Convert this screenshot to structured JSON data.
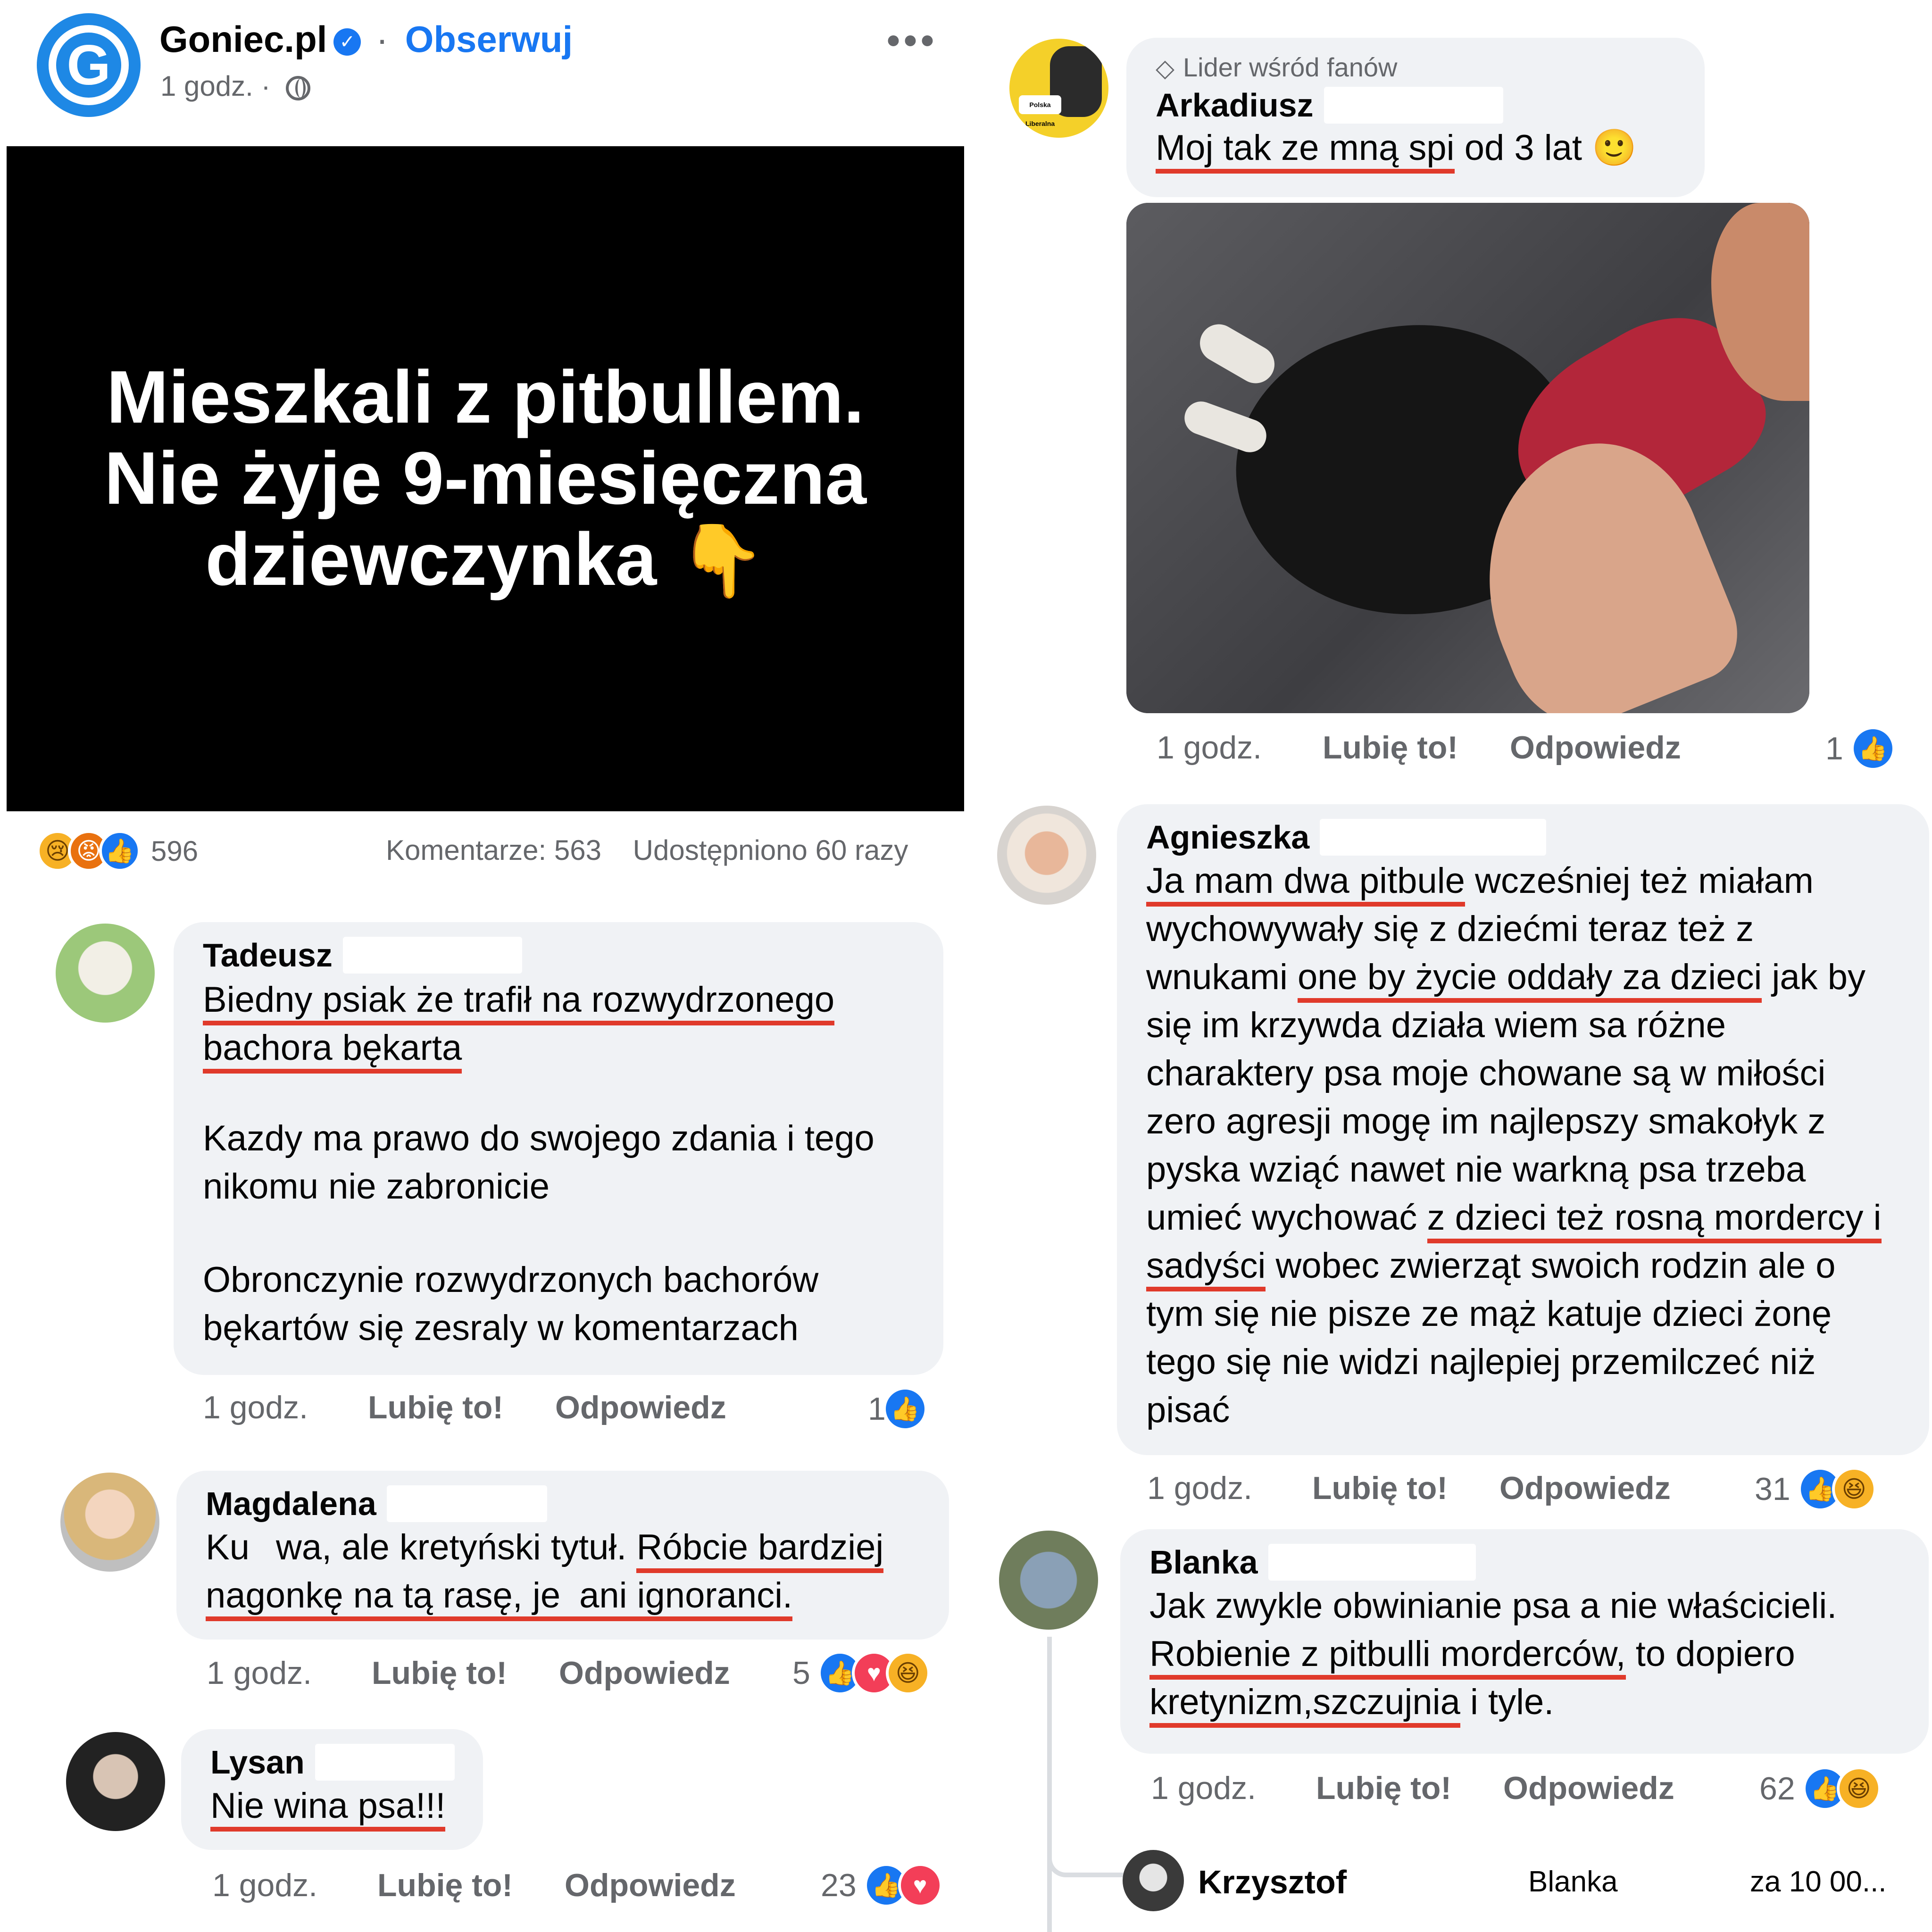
{
  "post": {
    "page_name": "Goniec.pl",
    "follow": "Obserwuj",
    "dot": "·",
    "time": "1 godz.",
    "time_dot": "·",
    "more": "•••",
    "logo_letter": "G",
    "headline_line1": "Mieszkali z pitbullem.",
    "headline_line2": "Nie żyje 9-miesięczna",
    "headline_line3": "dziewczynka",
    "headline_emoji": "👇",
    "reaction_count": "596",
    "comments": "Komentarze: 563",
    "shares": "Udostępniono 60 razy"
  },
  "icons": {
    "verified": "✓",
    "like": "👍",
    "love": "♥",
    "haha": "😆",
    "sad": "😢",
    "angry": "😡",
    "gem": "◇"
  },
  "labels": {
    "time": "1 godz.",
    "like": "Lubię to!",
    "reply": "Odpowiedz"
  },
  "comments_left": [
    {
      "author": "Tadeusz",
      "p1_u": "Biedny psiak że trafił na rozwydrzonego",
      "p1_u2": "bachora bękarta",
      "p2": "Kazdy ma prawo do swojego zdania i tego nikomu nie zabronicie",
      "p3": "Obronczynie rozwydrzonych bachorów bękartów się zesraly w komentarzach",
      "count": "1"
    },
    {
      "author": "Magdalena",
      "a": "Ku",
      "b": "wa, ale kretyński tytuł.",
      "u1": "Róbcie bardziej",
      "u2a": "nagonkę na tą rasę, je",
      "u2b": "ani ignoranci.",
      "count": "5"
    },
    {
      "author": "Lysan",
      "u": "Nie wina psa!!!",
      "count": "23"
    }
  ],
  "comments_right": [
    {
      "badge": "Lider wśród fanów",
      "author": "Arkadiusz",
      "u": "Moj tak ze mną spi",
      "rest": "od 3 lat",
      "emoji": "🙂",
      "count": "1",
      "avatar_badge": "Polska Liberalna"
    },
    {
      "author": "Agnieszka",
      "u1": "Ja mam dwa pitbule",
      "t1": "wcześniej też miałam wychowywały się z dziećmi teraz też z wnukami",
      "u2": "one by życie oddały za dzieci",
      "t2": "jak by się im krzywda działa wiem sa różne charaktery psa moje chowane są w miłości zero agresji mogę im najlepszy smakołyk z pyska wziąć nawet nie warkną psa trzeba umieć wychować",
      "u3": "z dzieci też rosną mordercy i sadyści",
      "t3": "wobec zwierząt swoich rodzin ale o tym się nie pisze ze mąż katuje dzieci żonę tego się nie widzi najlepiej przemilczeć niż pisać",
      "count": "31"
    },
    {
      "author": "Blanka",
      "t1": "Jak zwykle obwinianie psa a nie właścicieli.",
      "u1": "Robienie z pitbulli morderców,",
      "t2": "to dopiero",
      "u2": "kretynizm,szczujnia",
      "t3": "i tyle.",
      "count": "62"
    },
    {
      "author": "Krzysztof",
      "mention": "Blanka",
      "preview": "za 10 00..."
    }
  ]
}
